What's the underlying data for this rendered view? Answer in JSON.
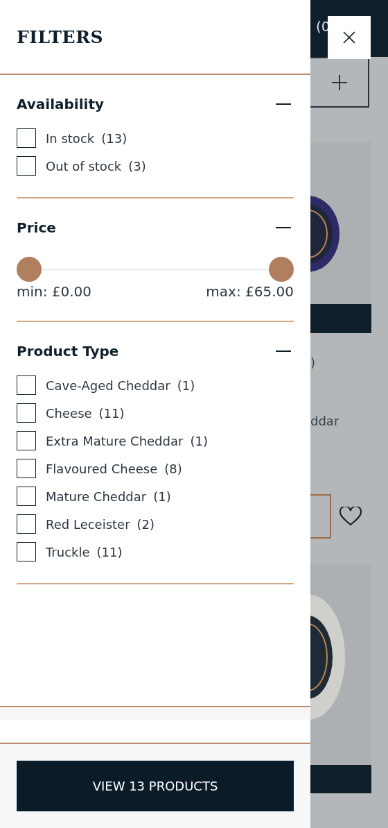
{
  "drawer": {
    "title": "FILTERS",
    "sections": [
      {
        "kind": "checkboxes",
        "title": "Availability",
        "expanded": true,
        "options": [
          {
            "label": "In stock",
            "count": "(13)",
            "checked": false
          },
          {
            "label": "Out of stock",
            "count": "(3)",
            "checked": false
          }
        ]
      },
      {
        "kind": "range",
        "title": "Price",
        "expanded": true,
        "handles": [
          {
            "label": "min: £0.00",
            "level": 0
          },
          {
            "label": "max: £65.00",
            "level": 1
          }
        ]
      },
      {
        "kind": "checkboxes",
        "title": "Product Type",
        "expanded": true,
        "options": [
          {
            "label": "Cave-Aged Cheddar",
            "count": "(1)",
            "checked": false
          },
          {
            "label": "Cheese",
            "count": "(11)",
            "checked": false
          },
          {
            "label": "Extra Mature Cheddar",
            "count": "(1)",
            "checked": false
          },
          {
            "label": "Flavoured Cheese",
            "count": "(8)",
            "checked": false
          },
          {
            "label": "Mature Cheddar",
            "count": "(1)",
            "checked": false
          },
          {
            "label": "Red Leceister",
            "count": "(2)",
            "checked": false
          },
          {
            "label": "Truckle",
            "count": "(11)",
            "checked": false
          }
        ]
      }
    ],
    "apply_button": "VIEW 13 PRODUCTS"
  },
  "background_page": {
    "header_text": "(0",
    "texts": [
      ")",
      "ddar"
    ]
  }
}
